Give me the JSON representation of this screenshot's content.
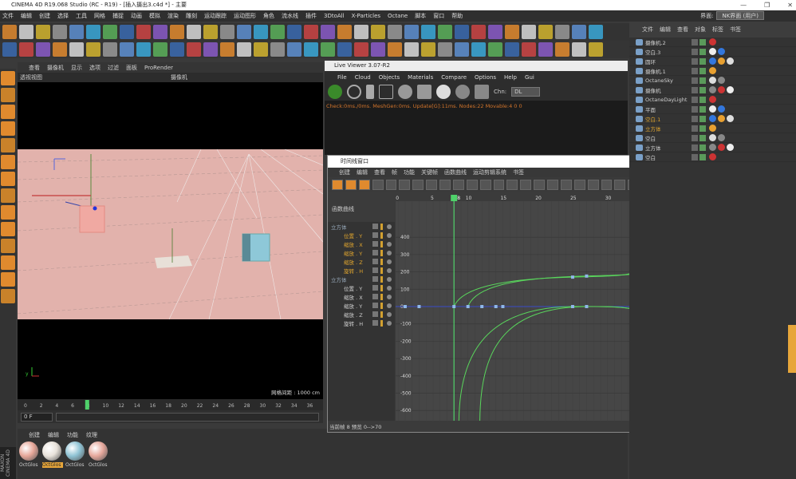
{
  "app": {
    "title": "CINEMA 4D R19.068 Studio (RC - R19) - [插入摄出3.c4d *] - 主要",
    "layout_label": "界面:",
    "layout_value": "NK界面 (用户)"
  },
  "main_menu": [
    "文件",
    "编辑",
    "创建",
    "选择",
    "工具",
    "网格",
    "捕捉",
    "动画",
    "模拟",
    "渲染",
    "雕刻",
    "运动跟踪",
    "运动图形",
    "角色",
    "流水线",
    "插件",
    "3DtoAll",
    "X-Particles",
    "Octane",
    "脚本",
    "窗口",
    "帮助"
  ],
  "viewport": {
    "menu": [
      "查看",
      "摄像机",
      "显示",
      "选项",
      "过滤",
      "面板",
      "ProRender"
    ],
    "name": "透视视图",
    "camera": "摄像机",
    "grid_label": "网格间距 : 1000 cm",
    "current_frame_field": "0 F",
    "frame_ticks": [
      "0",
      "2",
      "4",
      "6",
      "8",
      "10",
      "12",
      "14",
      "16",
      "18",
      "20",
      "22",
      "24",
      "26",
      "28",
      "30",
      "32",
      "34",
      "36"
    ],
    "current_frame": 8
  },
  "live_viewer": {
    "title": "Live Viewer 3.07-R2",
    "menu": [
      "File",
      "Cloud",
      "Objects",
      "Materials",
      "Compare",
      "Options",
      "Help",
      "Gui"
    ],
    "channel_label": "Chn:",
    "channel_value": "DL",
    "status": "Check:0ms./0ms. MeshGen:0ms. Update[G]:11ms. Nodes:22 Movable:4  0 0"
  },
  "timeline_window": {
    "title": "时间线窗口",
    "menu": [
      "创建",
      "编辑",
      "查看",
      "帧",
      "功能",
      "关键帧",
      "函数曲线",
      "运动剪辑系统",
      "书签"
    ],
    "panel_label": "函数曲线",
    "frame_ticks": [
      "0",
      "5",
      "10",
      "15",
      "20",
      "25",
      "30",
      "35",
      "40",
      "45",
      "50"
    ],
    "current_frame_label": "8",
    "y_ticks": [
      "400",
      "300",
      "200",
      "100",
      "0",
      "-100",
      "-200",
      "-300",
      "-400",
      "-500",
      "-600",
      "-700"
    ],
    "tracks": [
      {
        "label": "立方体",
        "type": "object"
      },
      {
        "label": "位置 . Y",
        "type": "track",
        "color": "#e0a52e"
      },
      {
        "label": "缩放 . X",
        "type": "track",
        "color": "#e0a52e"
      },
      {
        "label": "缩放 . Y",
        "type": "track",
        "color": "#e0a52e"
      },
      {
        "label": "缩放 . Z",
        "type": "track",
        "color": "#e0a52e"
      },
      {
        "label": "旋转 . H",
        "type": "track",
        "color": "#e0a52e"
      },
      {
        "label": "立方体",
        "type": "object"
      },
      {
        "label": "位置 . Y",
        "type": "track",
        "color": "#cfcfcf"
      },
      {
        "label": "缩放 . X",
        "type": "track",
        "color": "#cfcfcf"
      },
      {
        "label": "缩放 . Y",
        "type": "track",
        "color": "#cfcfcf"
      },
      {
        "label": "缩放 . Z",
        "type": "track",
        "color": "#cfcfcf"
      },
      {
        "label": "旋转 . H",
        "type": "track",
        "color": "#cfcfcf"
      }
    ],
    "status": "当前帧  8  预览  0-->70"
  },
  "object_manager": {
    "tabs": [
      "文件",
      "编辑",
      "查看",
      "对象",
      "标签",
      "书签"
    ],
    "objects": [
      {
        "name": "摄像机.2",
        "color": "#cfcfcf"
      },
      {
        "name": "空白.3",
        "color": "#cfcfcf"
      },
      {
        "name": "圆环",
        "color": "#cfcfcf"
      },
      {
        "name": "摄像机.1",
        "color": "#cfcfcf"
      },
      {
        "name": "OctaneSky",
        "color": "#cfcfcf"
      },
      {
        "name": "摄像机",
        "color": "#cfcfcf"
      },
      {
        "name": "OctaneDayLight",
        "color": "#cfcfcf"
      },
      {
        "name": "平面",
        "color": "#cfcfcf"
      },
      {
        "name": "空白.1",
        "color": "#e0a52e"
      },
      {
        "name": "立方体",
        "color": "#e0a52e"
      },
      {
        "name": "空白",
        "color": "#cfcfcf"
      },
      {
        "name": "立方体",
        "color": "#cfcfcf"
      },
      {
        "name": "空白",
        "color": "#cfcfcf"
      }
    ]
  },
  "materials": {
    "menu": [
      "创建",
      "编辑",
      "功能",
      "纹理"
    ],
    "items": [
      {
        "label": "OctGlos",
        "color": "#e7a799"
      },
      {
        "label": "OctGlos",
        "color": "#e8e2da"
      },
      {
        "label": "OctGlos",
        "color": "#8fc3d4"
      },
      {
        "label": "OctGlos",
        "color": "#e6a89c"
      }
    ],
    "brand": "MAXON CINEMA 4D"
  }
}
